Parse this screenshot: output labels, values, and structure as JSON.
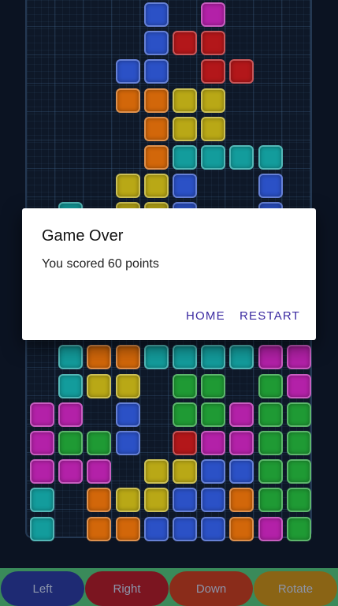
{
  "dialog": {
    "title": "Game Over",
    "message": "You scored 60 points",
    "home_label": "HOME",
    "restart_label": "RESTART"
  },
  "controls": {
    "left_label": "Left",
    "right_label": "Right",
    "down_label": "Down",
    "rotate_label": "Rotate"
  },
  "colors": {
    "blue": "#2b51c6",
    "red": "#b3171a",
    "magenta": "#b321a8",
    "orange": "#d2670a",
    "yellow": "#b9a816",
    "cyan": "#139c9c",
    "green": "#1f9a34"
  },
  "board": {
    "columns": 10,
    "rows": 19,
    "cells": [
      [
        4,
        0,
        "blue"
      ],
      [
        6,
        0,
        "magenta"
      ],
      [
        4,
        1,
        "blue"
      ],
      [
        5,
        1,
        "red"
      ],
      [
        6,
        1,
        "red"
      ],
      [
        3,
        2,
        "blue"
      ],
      [
        4,
        2,
        "blue"
      ],
      [
        6,
        2,
        "red"
      ],
      [
        7,
        2,
        "red"
      ],
      [
        3,
        3,
        "orange"
      ],
      [
        4,
        3,
        "orange"
      ],
      [
        5,
        3,
        "yellow"
      ],
      [
        6,
        3,
        "yellow"
      ],
      [
        4,
        4,
        "orange"
      ],
      [
        5,
        4,
        "yellow"
      ],
      [
        6,
        4,
        "yellow"
      ],
      [
        4,
        5,
        "orange"
      ],
      [
        5,
        5,
        "cyan"
      ],
      [
        6,
        5,
        "cyan"
      ],
      [
        7,
        5,
        "cyan"
      ],
      [
        8,
        5,
        "cyan"
      ],
      [
        3,
        6,
        "yellow"
      ],
      [
        4,
        6,
        "yellow"
      ],
      [
        5,
        6,
        "blue"
      ],
      [
        8,
        6,
        "blue"
      ],
      [
        1,
        7,
        "cyan"
      ],
      [
        3,
        7,
        "yellow"
      ],
      [
        4,
        7,
        "yellow"
      ],
      [
        5,
        7,
        "blue"
      ],
      [
        8,
        7,
        "blue"
      ],
      [
        1,
        12,
        "cyan"
      ],
      [
        2,
        12,
        "orange"
      ],
      [
        3,
        12,
        "orange"
      ],
      [
        4,
        12,
        "cyan"
      ],
      [
        5,
        12,
        "cyan"
      ],
      [
        6,
        12,
        "cyan"
      ],
      [
        7,
        12,
        "cyan"
      ],
      [
        8,
        12,
        "magenta"
      ],
      [
        9,
        12,
        "magenta"
      ],
      [
        1,
        13,
        "cyan"
      ],
      [
        2,
        13,
        "yellow"
      ],
      [
        3,
        13,
        "yellow"
      ],
      [
        5,
        13,
        "green"
      ],
      [
        6,
        13,
        "green"
      ],
      [
        8,
        13,
        "green"
      ],
      [
        9,
        13,
        "magenta"
      ],
      [
        0,
        14,
        "magenta"
      ],
      [
        1,
        14,
        "magenta"
      ],
      [
        3,
        14,
        "blue"
      ],
      [
        5,
        14,
        "green"
      ],
      [
        6,
        14,
        "green"
      ],
      [
        7,
        14,
        "magenta"
      ],
      [
        8,
        14,
        "green"
      ],
      [
        9,
        14,
        "green"
      ],
      [
        0,
        15,
        "magenta"
      ],
      [
        1,
        15,
        "green"
      ],
      [
        2,
        15,
        "green"
      ],
      [
        3,
        15,
        "blue"
      ],
      [
        5,
        15,
        "red"
      ],
      [
        6,
        15,
        "magenta"
      ],
      [
        7,
        15,
        "magenta"
      ],
      [
        8,
        15,
        "green"
      ],
      [
        9,
        15,
        "green"
      ],
      [
        0,
        16,
        "magenta"
      ],
      [
        1,
        16,
        "magenta"
      ],
      [
        2,
        16,
        "magenta"
      ],
      [
        4,
        16,
        "yellow"
      ],
      [
        5,
        16,
        "yellow"
      ],
      [
        6,
        16,
        "blue"
      ],
      [
        7,
        16,
        "blue"
      ],
      [
        8,
        16,
        "green"
      ],
      [
        9,
        16,
        "green"
      ],
      [
        0,
        17,
        "cyan"
      ],
      [
        2,
        17,
        "orange"
      ],
      [
        3,
        17,
        "yellow"
      ],
      [
        4,
        17,
        "yellow"
      ],
      [
        5,
        17,
        "blue"
      ],
      [
        6,
        17,
        "blue"
      ],
      [
        7,
        17,
        "orange"
      ],
      [
        8,
        17,
        "green"
      ],
      [
        9,
        17,
        "green"
      ],
      [
        0,
        18,
        "cyan"
      ],
      [
        2,
        18,
        "orange"
      ],
      [
        3,
        18,
        "orange"
      ],
      [
        4,
        18,
        "blue"
      ],
      [
        5,
        18,
        "blue"
      ],
      [
        6,
        18,
        "blue"
      ],
      [
        7,
        18,
        "orange"
      ],
      [
        8,
        18,
        "magenta"
      ],
      [
        9,
        18,
        "green"
      ]
    ]
  }
}
